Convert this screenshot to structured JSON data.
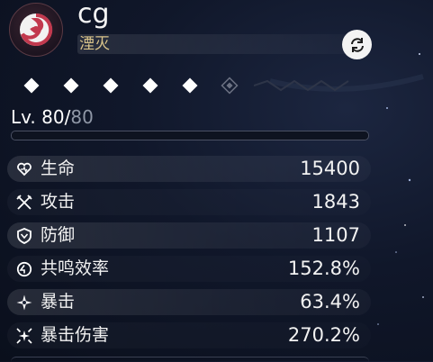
{
  "character": {
    "name": "cg",
    "subtitle": "湮灭"
  },
  "icons": {
    "emblem": "havoc-element-emblem",
    "swap": "swap-refresh-icon",
    "node": "diamond-node-icon"
  },
  "resonance_nodes": {
    "active": 5,
    "total": 6
  },
  "level": {
    "prefix": "Lv. ",
    "current": "80",
    "separator": "/",
    "max": "80"
  },
  "stats": [
    {
      "label": "生命",
      "value": "15400",
      "icon": "hp-heart-icon"
    },
    {
      "label": "攻击",
      "value": "1843",
      "icon": "atk-swords-icon"
    },
    {
      "label": "防御",
      "value": "1107",
      "icon": "def-shield-icon"
    },
    {
      "label": "共鸣效率",
      "value": "152.8%",
      "icon": "energy-regen-icon"
    },
    {
      "label": "暴击",
      "value": "63.4%",
      "icon": "crit-rate-icon"
    },
    {
      "label": "暴击伤害",
      "value": "270.2%",
      "icon": "crit-dmg-icon"
    }
  ],
  "colors": {
    "accent_gold": "#d9c48b",
    "emblem_red": "#c2394e",
    "text": "#f2f2f2",
    "muted": "#8f97a6"
  }
}
